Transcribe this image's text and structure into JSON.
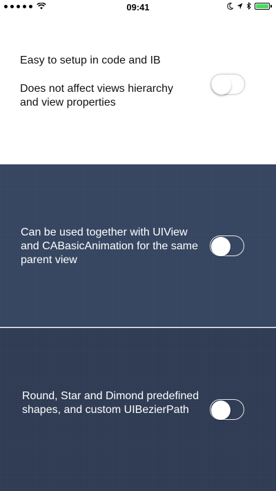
{
  "status_bar": {
    "time": "09:41",
    "wifi_icon": "wifi-icon",
    "moon_icon": "moon-icon",
    "location_icon": "location-arrow-icon",
    "bluetooth_icon": "bluetooth-icon",
    "battery_icon": "battery-icon",
    "battery_color": "#4cd964",
    "battery_level": 1.0
  },
  "sections": [
    {
      "background": "#ffffff",
      "lines": [
        "Easy to setup in code and IB",
        "Does not affect views hierarchy and view properties"
      ],
      "switch_on": false
    },
    {
      "background": "#34445f",
      "text": "Can be used together with UIView and CABasicAnimation for the same parent view",
      "switch_on": false
    },
    {
      "background": "#2d3a52",
      "text": "Round, Star and Dimond predefined shapes, and custom UIBezierPath",
      "switch_on": false
    }
  ]
}
